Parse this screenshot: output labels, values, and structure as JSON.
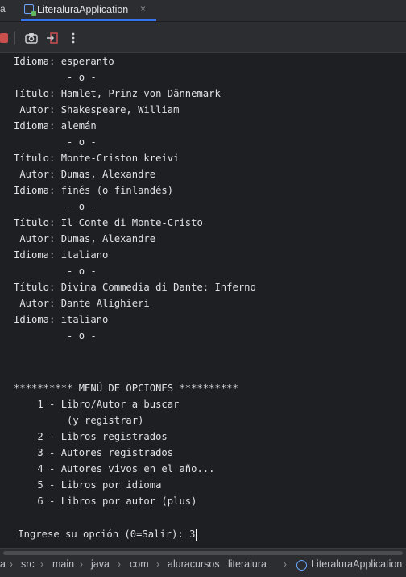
{
  "tabbar": {
    "left_fragment": "a",
    "active_tab": {
      "label": "LiteraluraApplication",
      "close_glyph": "×"
    }
  },
  "toolbar": {
    "buttons": [
      {
        "name": "stop",
        "icon": "stop-icon"
      },
      {
        "name": "screenshot",
        "icon": "camera-icon"
      },
      {
        "name": "exit",
        "icon": "exit-icon"
      },
      {
        "name": "more",
        "icon": "more-icon"
      }
    ]
  },
  "console": {
    "lines": [
      "Idioma: esperanto",
      "         - o -",
      "Título: Hamlet, Prinz von Dännemark",
      " Autor: Shakespeare, William",
      "Idioma: alemán",
      "         - o -",
      "Título: Monte-Criston kreivi",
      " Autor: Dumas, Alexandre",
      "Idioma: finés (o finlandés)",
      "         - o -",
      "Título: Il Conte di Monte-Cristo",
      " Autor: Dumas, Alexandre",
      "Idioma: italiano",
      "         - o -",
      "Título: Divina Commedia di Dante: Inferno",
      " Autor: Dante Alighieri",
      "Idioma: italiano",
      "         - o -",
      "",
      "",
      "********** MENÚ DE OPCIONES **********",
      "    1 - Libro/Autor a buscar",
      "         (y registrar)",
      "    2 - Libros registrados",
      "    3 - Autores registrados",
      "    4 - Autores vivos en el año...",
      "    5 - Libros por idioma",
      "    6 - Libros por autor (plus)",
      ""
    ],
    "prompt": " Ingrese su opción (0=Salir): ",
    "input_value": "3"
  },
  "breadcrumb": {
    "items": [
      "a",
      "src",
      "main",
      "java",
      "com",
      "aluracursos",
      "literalura",
      "LiteraluraApplication"
    ]
  },
  "colors": {
    "background": "#1e1f22",
    "panel": "#2b2d30",
    "text": "#dfe1e5",
    "accent": "#3574f0",
    "stop": "#c94f4f"
  }
}
